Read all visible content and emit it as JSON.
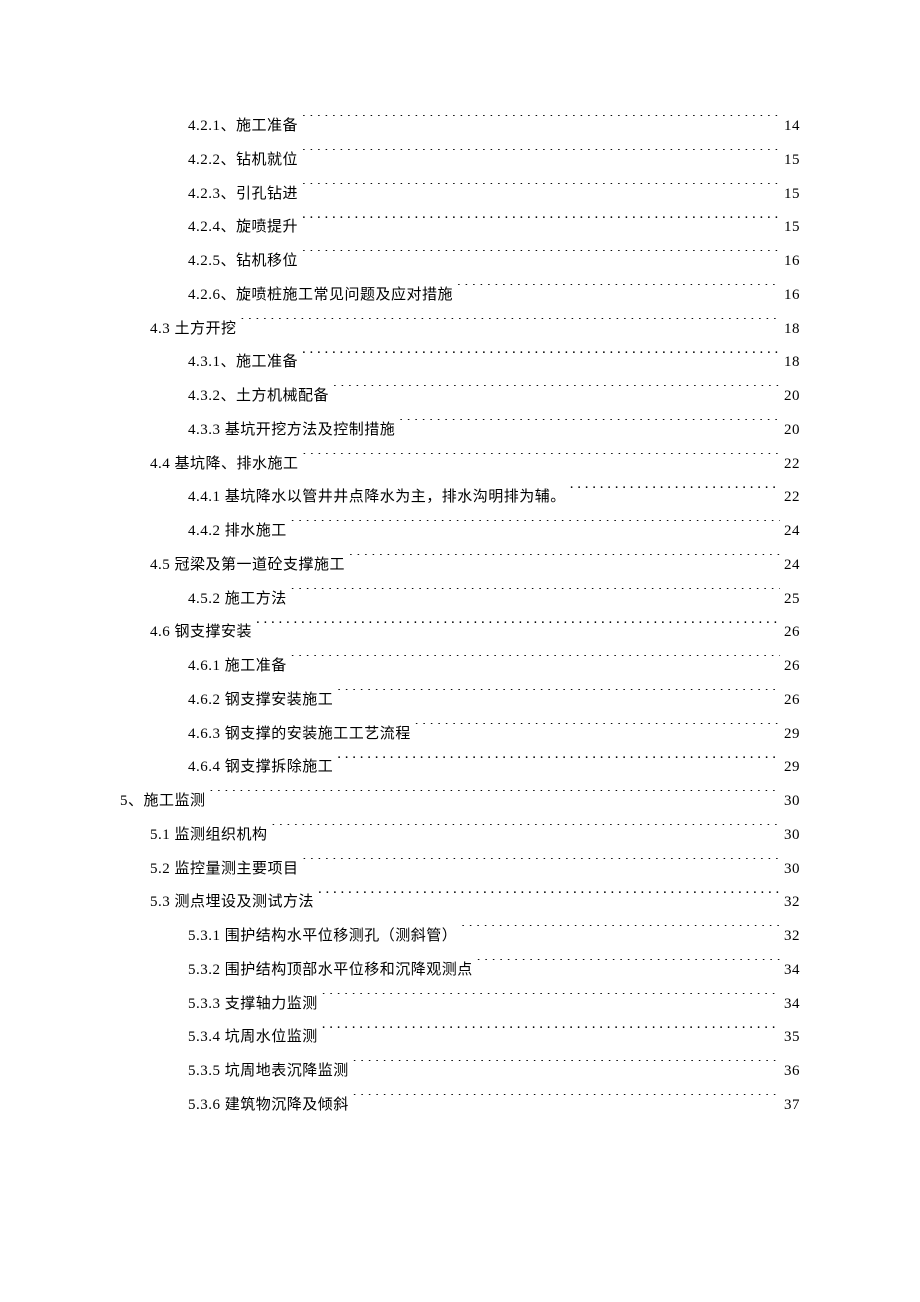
{
  "toc": [
    {
      "indent": 3,
      "label": "4.2.1、施工准备",
      "page": "14"
    },
    {
      "indent": 3,
      "label": "4.2.2、钻机就位",
      "page": "15"
    },
    {
      "indent": 3,
      "label": "4.2.3、引孔钻进",
      "page": "15"
    },
    {
      "indent": 3,
      "label": "4.2.4、旋喷提升",
      "page": "15"
    },
    {
      "indent": 3,
      "label": "4.2.5、钻机移位",
      "page": "16"
    },
    {
      "indent": 3,
      "label": "4.2.6、旋喷桩施工常见问题及应对措施",
      "page": "16"
    },
    {
      "indent": 2,
      "label": "4.3 土方开挖",
      "page": "18"
    },
    {
      "indent": 3,
      "label": "4.3.1、施工准备",
      "page": "18"
    },
    {
      "indent": 3,
      "label": "4.3.2、土方机械配备",
      "page": "20"
    },
    {
      "indent": 3,
      "label": "4.3.3 基坑开挖方法及控制措施",
      "page": "20"
    },
    {
      "indent": 2,
      "label": "4.4 基坑降、排水施工",
      "page": "22"
    },
    {
      "indent": 3,
      "label": "4.4.1 基坑降水以管井井点降水为主，排水沟明排为辅。",
      "page": "22"
    },
    {
      "indent": 3,
      "label": "4.4.2 排水施工",
      "page": "24"
    },
    {
      "indent": 2,
      "label": "4.5 冠梁及第一道砼支撑施工",
      "page": "24"
    },
    {
      "indent": 3,
      "label": "4.5.2 施工方法",
      "page": "25"
    },
    {
      "indent": 2,
      "label": "4.6 钢支撑安装",
      "page": "26"
    },
    {
      "indent": 3,
      "label": "4.6.1 施工准备",
      "page": "26"
    },
    {
      "indent": 3,
      "label": "4.6.2 钢支撑安装施工",
      "page": "26"
    },
    {
      "indent": 3,
      "label": "4.6.3 钢支撑的安装施工工艺流程",
      "page": "29"
    },
    {
      "indent": 3,
      "label": "4.6.4 钢支撑拆除施工",
      "page": "29"
    },
    {
      "indent": 1,
      "label": "5、施工监测",
      "page": "30"
    },
    {
      "indent": 2,
      "label": "5.1 监测组织机构",
      "page": "30"
    },
    {
      "indent": 2,
      "label": "5.2 监控量测主要项目",
      "page": "30"
    },
    {
      "indent": 2,
      "label": "5.3 测点埋设及测试方法",
      "page": "32"
    },
    {
      "indent": 3,
      "label": "5.3.1 围护结构水平位移测孔（测斜管）",
      "page": "32"
    },
    {
      "indent": 3,
      "label": "5.3.2 围护结构顶部水平位移和沉降观测点",
      "page": "34"
    },
    {
      "indent": 3,
      "label": "5.3.3 支撑轴力监测",
      "page": "34"
    },
    {
      "indent": 3,
      "label": "5.3.4 坑周水位监测",
      "page": "35"
    },
    {
      "indent": 3,
      "label": "5.3.5 坑周地表沉降监测",
      "page": "36"
    },
    {
      "indent": 3,
      "label": "5.3.6 建筑物沉降及倾斜",
      "page": "37"
    }
  ]
}
